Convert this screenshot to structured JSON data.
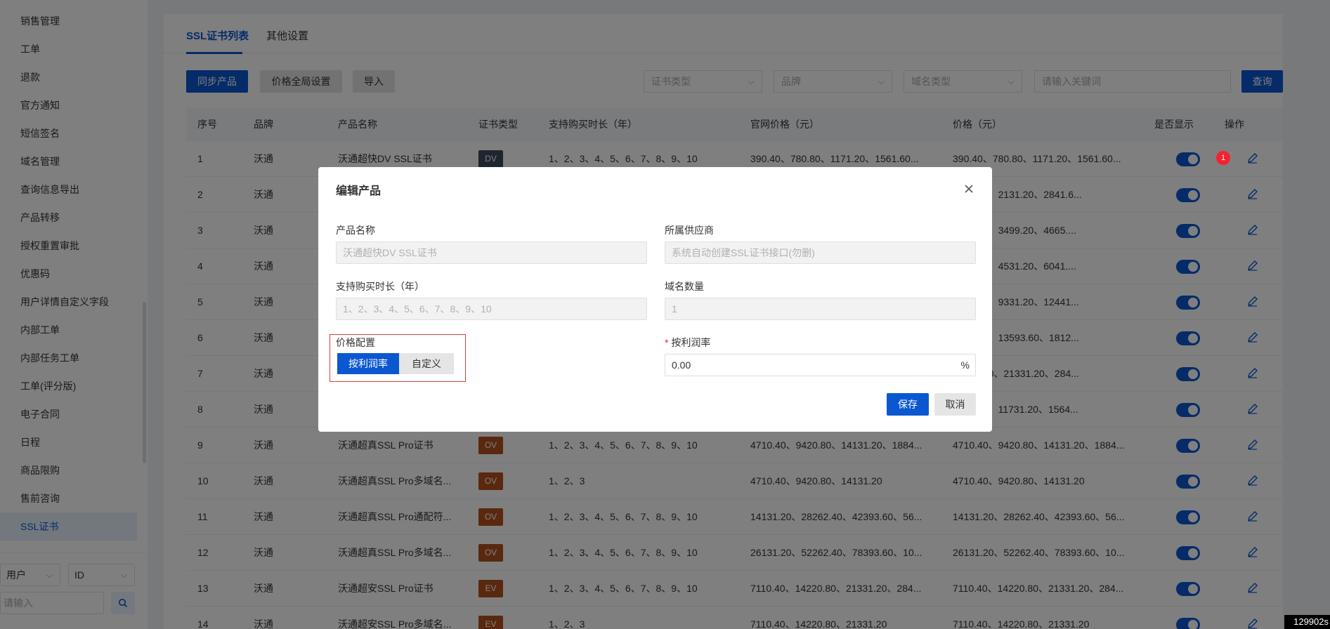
{
  "sidebar": {
    "items": [
      {
        "label": "销售管理"
      },
      {
        "label": "工单"
      },
      {
        "label": "退款"
      },
      {
        "label": "官方通知"
      },
      {
        "label": "短信签名"
      },
      {
        "label": "域名管理"
      },
      {
        "label": "查询信息导出"
      },
      {
        "label": "产品转移"
      },
      {
        "label": "授权重置审批"
      },
      {
        "label": "优惠码"
      },
      {
        "label": "用户详情自定义字段"
      },
      {
        "label": "内部工单"
      },
      {
        "label": "内部任务工单"
      },
      {
        "label": "工单(评分版)"
      },
      {
        "label": "电子合同"
      },
      {
        "label": "日程"
      },
      {
        "label": "商品限购"
      },
      {
        "label": "售前咨询"
      },
      {
        "label": "SSL证书",
        "active": true
      }
    ],
    "filter": {
      "scope_select": "用户",
      "field_select": "ID",
      "input_placeholder": "请输入",
      "search_icon": "search-icon"
    }
  },
  "tabs": [
    {
      "label": "SSL证书列表",
      "active": true
    },
    {
      "label": "其他设置"
    }
  ],
  "toolbar": {
    "sync_label": "同步产品",
    "global_price_label": "价格全局设置",
    "import_label": "导入",
    "cert_type_placeholder": "证书类型",
    "brand_placeholder": "品牌",
    "domain_type_placeholder": "域名类型",
    "keyword_placeholder": "请输入关键词",
    "query_label": "查询"
  },
  "table": {
    "columns": [
      "序号",
      "品牌",
      "产品名称",
      "证书类型",
      "支持购买时长（年）",
      "官网价格（元）",
      "价格（元）",
      "是否显示",
      "操作"
    ],
    "rows": [
      {
        "no": "1",
        "brand": "沃通",
        "name": "沃通超快DV SSL证书",
        "type": "DV",
        "years": "1、2、3、4、5、6、7、8、9、10",
        "official": "390.40、780.80、1171.20、1561.60...",
        "price": "390.40、780.80、1171.20、1561.60..."
      },
      {
        "no": "2",
        "brand": "沃通",
        "name": "",
        "type": "",
        "years": "",
        "official": "",
        "price": "1420.80、2131.20、2841.6..."
      },
      {
        "no": "3",
        "brand": "沃通",
        "name": "",
        "type": "",
        "years": "",
        "official": "",
        "price": "2332.80、3499.20、4665...."
      },
      {
        "no": "4",
        "brand": "沃通",
        "name": "",
        "type": "",
        "years": "",
        "official": "",
        "price": "3020.80、4531.20、6041...."
      },
      {
        "no": "5",
        "brand": "沃通",
        "name": "",
        "type": "",
        "years": "",
        "official": "",
        "price": "6220.80、9331.20、12441..."
      },
      {
        "no": "6",
        "brand": "沃通",
        "name": "",
        "type": "",
        "years": "",
        "official": "",
        "price": "9062.40、13593.60、1812..."
      },
      {
        "no": "7",
        "brand": "沃通",
        "name": "",
        "type": "",
        "years": "",
        "official": "",
        "price": "14220.80、21331.20、284..."
      },
      {
        "no": "8",
        "brand": "沃通",
        "name": "",
        "type": "",
        "years": "",
        "official": "",
        "price": "7820.80、11731.20、1564..."
      },
      {
        "no": "9",
        "brand": "沃通",
        "name": "沃通超真SSL Pro证书",
        "type": "OV",
        "years": "1、2、3、4、5、6、7、8、9、10",
        "official": "4710.40、9420.80、14131.20、1884...",
        "price": "4710.40、9420.80、14131.20、1884..."
      },
      {
        "no": "10",
        "brand": "沃通",
        "name": "沃通超真SSL Pro多域名...",
        "type": "OV",
        "years": "1、2、3",
        "official": "4710.40、9420.80、14131.20",
        "price": "4710.40、9420.80、14131.20"
      },
      {
        "no": "11",
        "brand": "沃通",
        "name": "沃通超真SSL Pro通配符...",
        "type": "OV",
        "years": "1、2、3、4、5、6、7、8、9、10",
        "official": "14131.20、28262.40、42393.60、56...",
        "price": "14131.20、28262.40、42393.60、56..."
      },
      {
        "no": "12",
        "brand": "沃通",
        "name": "沃通超真SSL Pro多域名...",
        "type": "OV",
        "years": "1、2、3、4、5、6、7、8、9、10",
        "official": "26131.20、52262.40、78393.60、10...",
        "price": "26131.20、52262.40、78393.60、10..."
      },
      {
        "no": "13",
        "brand": "沃通",
        "name": "沃通超安SSL Pro证书",
        "type": "EV",
        "years": "1、2、3、4、5、6、7、8、9、10",
        "official": "7110.40、14220.80、21331.20、284...",
        "price": "7110.40、14220.80、21331.20、284..."
      },
      {
        "no": "14",
        "brand": "沃通",
        "name": "沃通超安SSL Pro多域名...",
        "type": "EV",
        "years": "1、2、3",
        "official": "7110.40、14220.80、21331.20",
        "price": "7110.40、14220.80、21331.20"
      }
    ],
    "badge_colors": {
      "DV": "#3d4a5c",
      "OV": "#b4511e",
      "EV": "#b4511e"
    },
    "notification_count": "1"
  },
  "modal": {
    "title": "编辑产品",
    "close_icon": "close-icon",
    "product_name_label": "产品名称",
    "product_name_value": "沃通超快DV SSL证书",
    "supplier_label": "所属供应商",
    "supplier_value": "系统自动创建SSL证书接口(勿删)",
    "years_label": "支持购买时长（年）",
    "years_value": "1、2、3、4、5、6、7、8、9、10",
    "domain_count_label": "域名数量",
    "domain_count_value": "1",
    "price_config_label": "价格配置",
    "price_config_options": [
      "按利润率",
      "自定义"
    ],
    "price_config_selected": "按利润率",
    "margin_required_mark": "*",
    "margin_label": "按利润率",
    "margin_value": "0.00",
    "margin_suffix": "%",
    "save_label": "保存",
    "cancel_label": "取消"
  },
  "corner_text": "129902s"
}
